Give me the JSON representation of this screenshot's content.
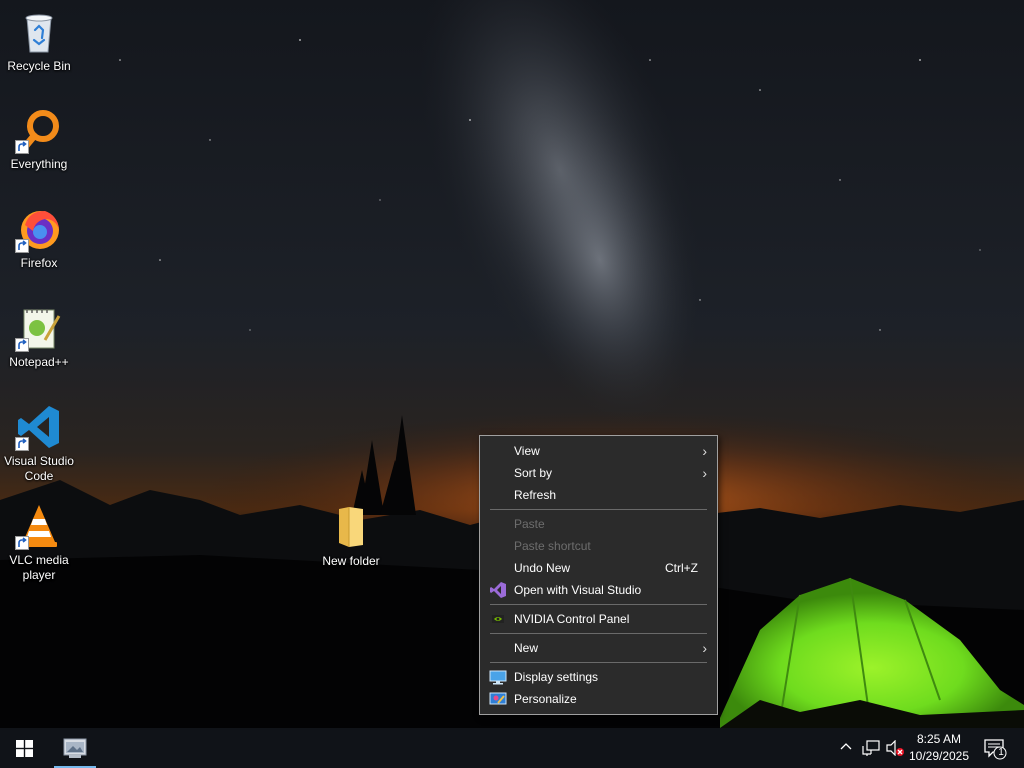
{
  "desktop": {
    "icons": [
      {
        "label": "Recycle Bin",
        "icon": "recycle-bin-icon"
      },
      {
        "label": "Everything",
        "icon": "everything-icon"
      },
      {
        "label": "Firefox",
        "icon": "firefox-icon"
      },
      {
        "label": "Notepad++",
        "icon": "notepadpp-icon"
      },
      {
        "label": "Visual Studio Code",
        "icon": "vscode-icon"
      },
      {
        "label": "VLC media player",
        "icon": "vlc-icon"
      },
      {
        "label": "New folder",
        "icon": "folder-icon"
      }
    ]
  },
  "context_menu": {
    "items": [
      {
        "label": "View",
        "submenu": true
      },
      {
        "label": "Sort by",
        "submenu": true
      },
      {
        "label": "Refresh"
      },
      {
        "label": "Paste",
        "disabled": true
      },
      {
        "label": "Paste shortcut",
        "disabled": true
      },
      {
        "label": "Undo New",
        "shortcut": "Ctrl+Z"
      },
      {
        "label": "Open with Visual Studio",
        "icon": "visual-studio-icon"
      },
      {
        "label": "NVIDIA Control Panel",
        "icon": "nvidia-icon"
      },
      {
        "label": "New",
        "submenu": true
      },
      {
        "label": "Display settings",
        "icon": "display-settings-icon"
      },
      {
        "label": "Personalize",
        "icon": "personalize-icon"
      }
    ]
  },
  "taskbar": {
    "start_icon": "windows-logo-icon",
    "pinned_app_icon": "app-window-icon",
    "tray_icons": [
      "chevron-up-icon",
      "network-icon",
      "volume-muted-icon"
    ],
    "clock_time": "8:25 AM",
    "clock_date": "10/29/2025",
    "notification_count": "1"
  },
  "colors": {
    "menu_background": "#2b2b2b",
    "menu_border": "#a0a0a0",
    "taskbar_background": "#101318",
    "tent_green": "#6fdc1e"
  }
}
